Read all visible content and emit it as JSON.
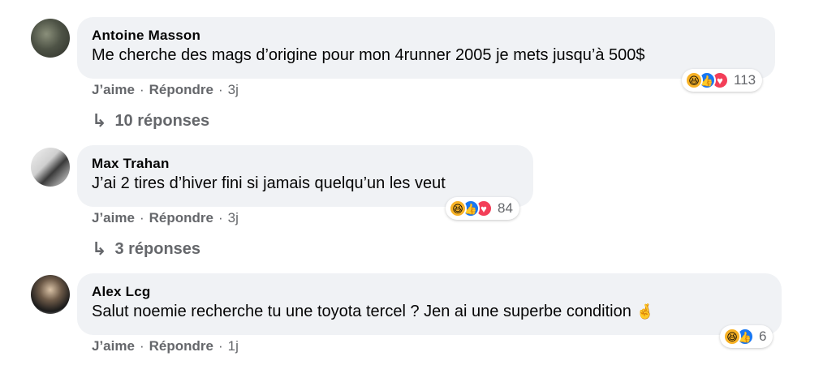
{
  "comments": [
    {
      "author": "Antoine Masson",
      "text": "Me cherche des mags d’origine pour mon 4runner 2005 je mets jusqu’à 500$",
      "reactions_count": "113",
      "like_label": "J’aime",
      "reply_label": "Répondre",
      "time": "3j",
      "replies_label": "10 réponses"
    },
    {
      "author": "Max Trahan",
      "text": "J’ai 2 tires d’hiver fini si jamais quelqu’un les veut",
      "reactions_count": "84",
      "like_label": "J’aime",
      "reply_label": "Répondre",
      "time": "3j",
      "replies_label": "3 réponses"
    },
    {
      "author": "Alex Lcg",
      "text": "Salut noemie recherche tu une toyota tercel ? Jen ai une superbe condition",
      "reactions_count": "6",
      "like_label": "J’aime",
      "reply_label": "Répondre",
      "time": "1j"
    }
  ],
  "colors": {
    "bubble": "#f0f2f5",
    "meta_text": "#65676b",
    "like_blue": "#1877f2",
    "love_red": "#f33e58",
    "haha_yellow": "#f7b125"
  },
  "icons": [
    "haha-reaction-icon",
    "like-reaction-icon",
    "love-reaction-icon",
    "reply-arrow-icon",
    "hand-emoji-icon"
  ]
}
